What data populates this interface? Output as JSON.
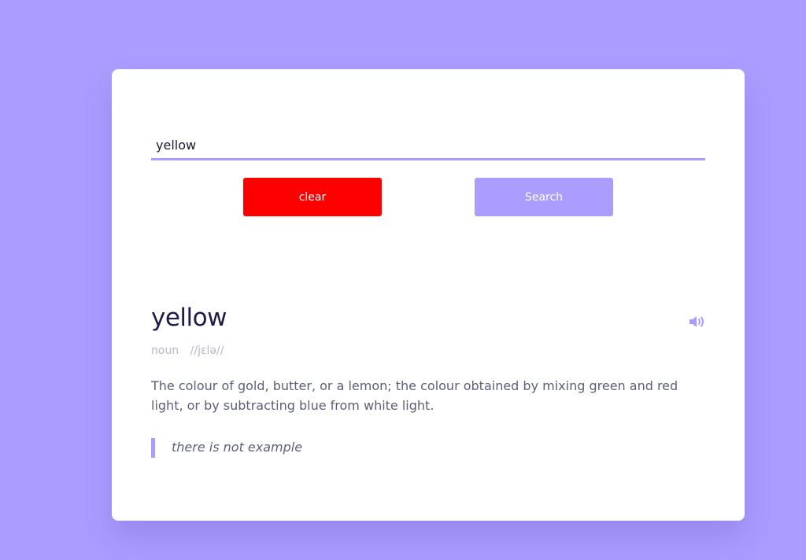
{
  "search": {
    "value": "yellow",
    "placeholder": ""
  },
  "buttons": {
    "clear_label": "clear",
    "search_label": "Search"
  },
  "result": {
    "word": "yellow",
    "part_of_speech": "noun",
    "phonetic": "//jɛlə//",
    "definition": "The colour of gold, butter, or a lemon; the colour obtained by mixing green and red light, or by subtracting blue from white light.",
    "example": "there is not example",
    "sound_icon": "speaker-icon"
  },
  "colors": {
    "background": "#ab9dff",
    "accent": "#ab9dff",
    "clear_button": "#ff0000",
    "card": "#ffffff"
  }
}
